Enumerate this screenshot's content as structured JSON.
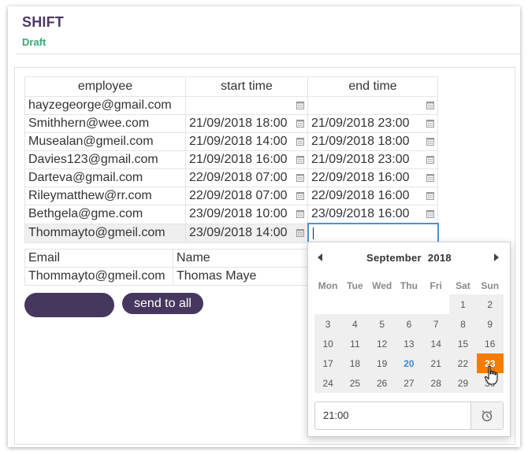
{
  "header": {
    "title": "SHIFT",
    "status": "Draft"
  },
  "shift_table": {
    "columns": [
      "employee",
      "start time",
      "end time"
    ],
    "rows": [
      {
        "employee": "hayzegeorge@gmail.com",
        "start": "",
        "end": ""
      },
      {
        "employee": "Smithhern@wee.com",
        "start": "21/09/2018 18:00",
        "end": "21/09/2018 23:00"
      },
      {
        "employee": "Musealan@gmeil.com",
        "start": "21/09/2018 14:00",
        "end": "21/09/2018 18:00"
      },
      {
        "employee": "Davies123@gmail.com",
        "start": "21/09/2018 16:00",
        "end": "21/09/2018 23:00"
      },
      {
        "employee": "Darteva@gmail.com",
        "start": "22/09/2018 07:00",
        "end": "22/09/2018 16:00"
      },
      {
        "employee": "Rileymatthew@rr.com",
        "start": "22/09/2018 07:00",
        "end": "22/09/2018 16:00"
      },
      {
        "employee": "Bethgela@gme.com",
        "start": "23/09/2018 10:00",
        "end": "23/09/2018 16:00"
      },
      {
        "employee": "Thommayto@gmeil.com",
        "start": "23/09/2018 14:00",
        "end": ""
      }
    ]
  },
  "email_table": {
    "columns": [
      "Email",
      "Name"
    ],
    "rows": [
      {
        "email": "Thommayto@gmeil.com",
        "name": "Thomas Maye"
      }
    ]
  },
  "buttons": {
    "blank_label": "",
    "send_label": "send to all"
  },
  "datepicker": {
    "month": "September",
    "year": "2018",
    "weekdays": [
      "Mon",
      "Tue",
      "Wed",
      "Thu",
      "Fri",
      "Sat",
      "Sun"
    ],
    "weeks": [
      [
        "",
        "",
        "",
        "",
        "",
        "1",
        "2"
      ],
      [
        "3",
        "4",
        "5",
        "6",
        "7",
        "8",
        "9"
      ],
      [
        "10",
        "11",
        "12",
        "13",
        "14",
        "15",
        "16"
      ],
      [
        "17",
        "18",
        "19",
        "20",
        "21",
        "22",
        "23"
      ],
      [
        "24",
        "25",
        "26",
        "27",
        "28",
        "29",
        "30"
      ]
    ],
    "today": "20",
    "selected": "23",
    "time": "21:00"
  },
  "colors": {
    "accent": "#46375e",
    "selected": "#f47c00",
    "today": "#3a8ad6",
    "draft": "#3aa876"
  },
  "icons": [
    "calendar-icon",
    "chevron-left-icon",
    "chevron-right-icon",
    "alarm-clock-icon",
    "hand-pointer-icon"
  ]
}
